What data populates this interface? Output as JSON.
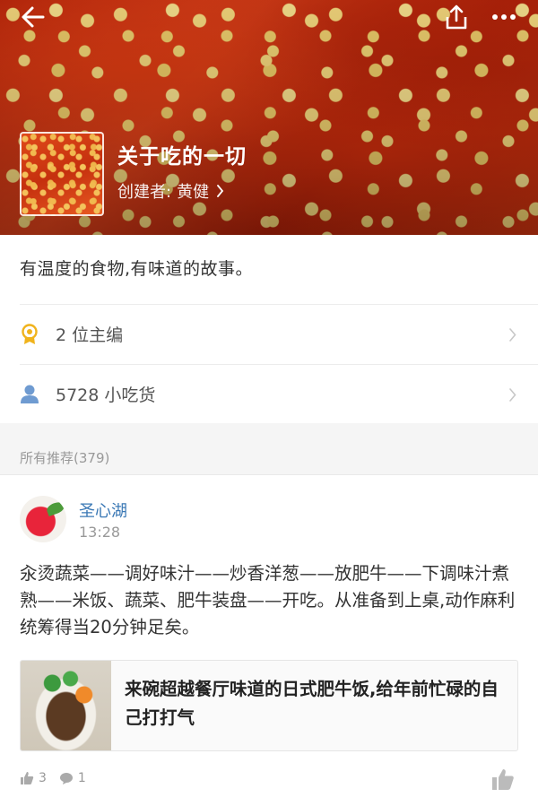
{
  "header": {
    "collection_title": "关于吃的一切",
    "creator_label": "创建者:",
    "creator_name": "黄健",
    "icons": [
      "back-icon",
      "share-icon",
      "more-icon"
    ]
  },
  "description": "有温度的食物,有味道的故事。",
  "stats": {
    "editors": "2 位主编",
    "fans": "5728 小吃货"
  },
  "section": {
    "title": "所有推荐(379)"
  },
  "post": {
    "author": "圣心湖",
    "time": "13:28",
    "body": "汆烫蔬菜——调好味汁——炒香洋葱——放肥牛——下调味汁煮熟——米饭、蔬菜、肥牛装盘——开吃。从准备到上桌,动作麻利统筹得当20分钟足矣。",
    "link_title": "来碗超越餐厅味道的日式肥牛饭,给年前忙碌的自己打打气",
    "likes": "3",
    "comments": "1"
  },
  "colors": {
    "author_link": "#3a78b5",
    "badge_gold": "#f0b31c",
    "user_blue": "#6f9bd1"
  }
}
